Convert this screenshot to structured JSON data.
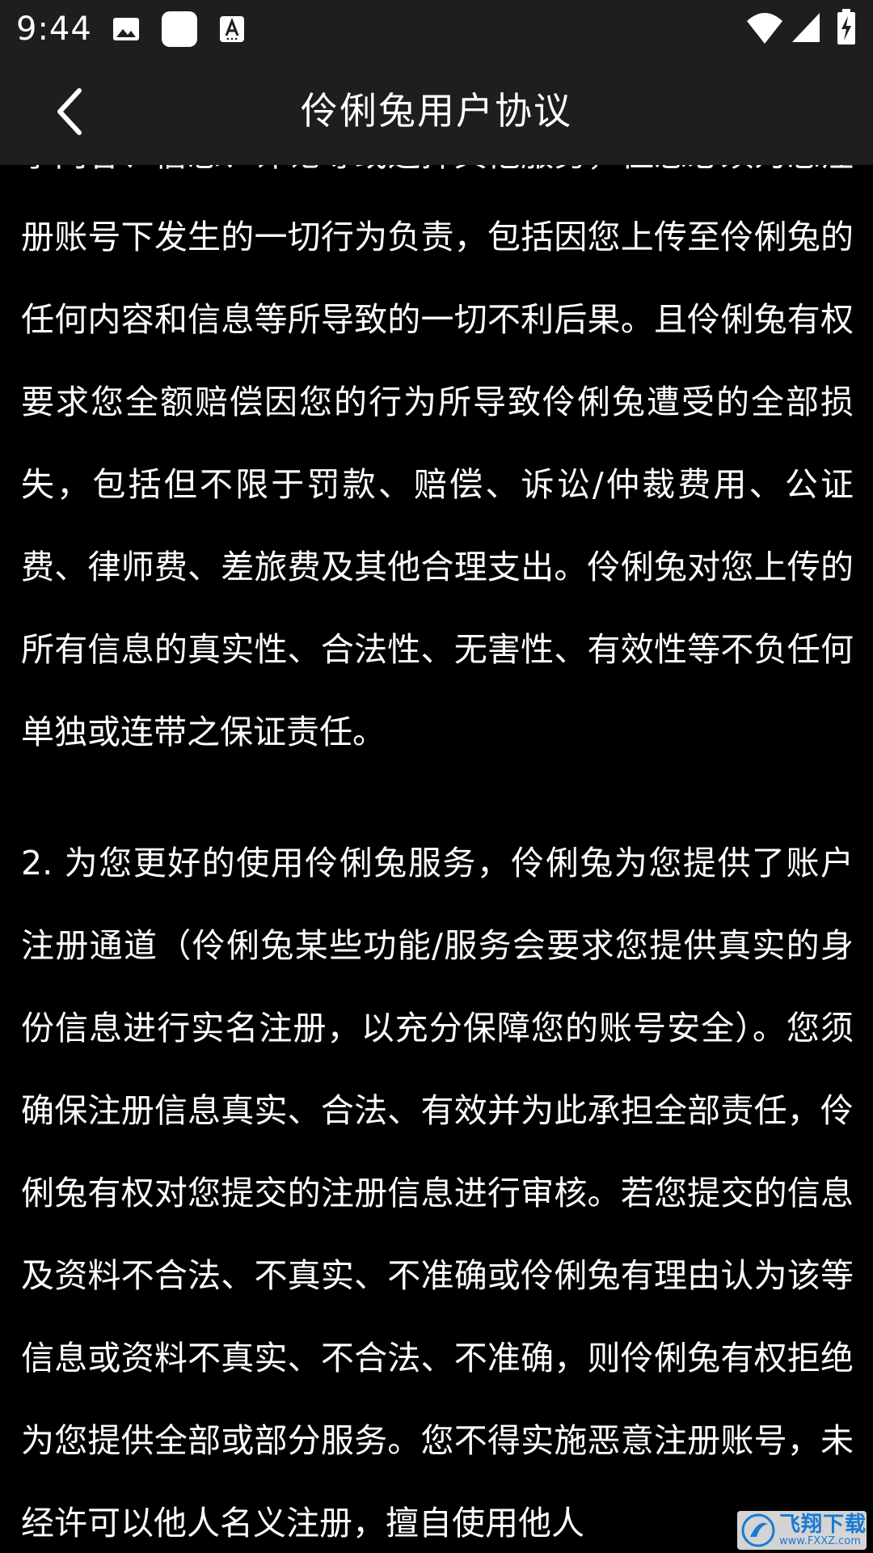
{
  "status_bar": {
    "time": "9:44",
    "icons": [
      "image-notification-icon",
      "blank-app-notification-icon",
      "font-app-notification-icon",
      "wifi-icon",
      "cell-signal-icon",
      "battery-charging-icon"
    ]
  },
  "header": {
    "title": "伶俐兔用户协议",
    "back_icon": "chevron-left-icon"
  },
  "content": {
    "paragraph_1": "享内容、信息、评论等或选择其他服务，但您必须为您注册账号下发生的一切行为负责，包括因您上传至伶俐兔的任何内容和信息等所导致的一切不利后果。且伶俐兔有权要求您全额赔偿因您的行为所导致伶俐兔遭受的全部损失，包括但不限于罚款、赔偿、诉讼/仲裁费用、公证费、律师费、差旅费及其他合理支出。伶俐兔对您上传的所有信息的真实性、合法性、无害性、有效性等不负任何单独或连带之保证责任。",
    "paragraph_2": "2. 为您更好的使用伶俐兔服务，伶俐兔为您提供了账户注册通道（伶俐兔某些功能/服务会要求您提供真实的身份信息进行实名注册，以充分保障您的账号安全）。您须确保注册信息真实、合法、有效并为此承担全部责任，伶俐兔有权对您提交的注册信息进行审核。若您提交的信息及资料不合法、不真实、不准确或伶俐兔有理由认为该等信息或资料不真实、不合法、不准确，则伶俐兔有权拒绝为您提供全部或部分服务。您不得实施恶意注册账号，未经许可以他人名义注册，擅自使用他人"
  },
  "watermark": {
    "text": "飞翔下载",
    "sub": "www.FXXZ.com"
  },
  "colors": {
    "background": "#000000",
    "bar_background": "#1e1e1e",
    "text": "#ffffff"
  }
}
